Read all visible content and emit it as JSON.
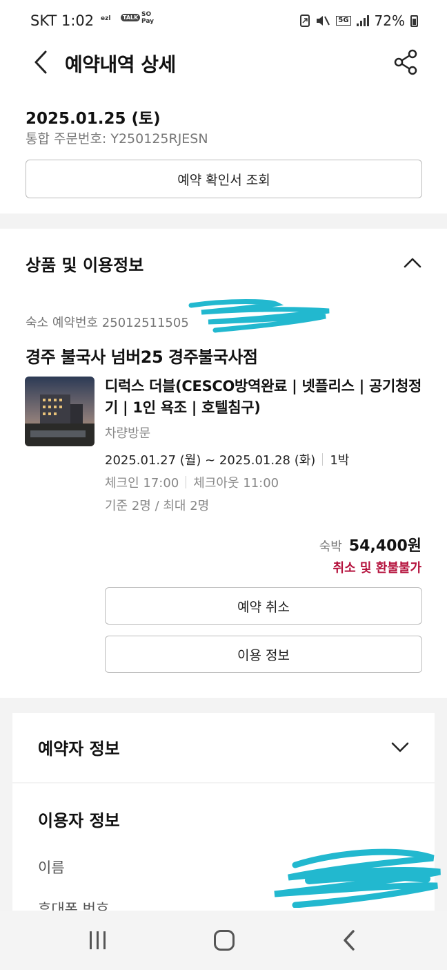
{
  "status_bar": {
    "carrier_time": "SKT 1:02",
    "icons": [
      "ezl",
      "TALK",
      "SO Pay"
    ],
    "network": "5G",
    "battery": "72%"
  },
  "header": {
    "title": "예약내역 상세",
    "back_icon": "chevron-left-icon",
    "share_icon": "share-icon"
  },
  "summary": {
    "date": "2025.01.25 (토)",
    "order_number": "통합 주문번호: Y250125RJESN",
    "confirm_button": "예약 확인서 조회"
  },
  "product_section": {
    "title": "상품 및 이용정보",
    "reservation_number": "숙소 예약번호 25012511505",
    "hotel_name": "경주 불국사 넘버25 경주불국사점",
    "room_name": "디럭스 더블(CESCO방역완료 | 넷플리스 | 공기청정기 | 1인 욕조 | 호텔침구)",
    "visit_type": "차량방문",
    "stay_dates": "2025.01.27 (월) ~ 2025.01.28 (화)",
    "nights": "1박",
    "check_in": "체크인 17:00",
    "check_out": "체크아웃 11:00",
    "guests": "기준 2명 / 최대 2명",
    "price_label": "숙박",
    "price": "54,400원",
    "refund_policy": "취소 및 환불불가",
    "cancel_button": "예약 취소",
    "info_button": "이용 정보"
  },
  "booker_section": {
    "title": "예약자 정보"
  },
  "user_section": {
    "title": "이용자 정보",
    "name_label": "이름",
    "phone_label": "휴대폰 번호"
  },
  "colors": {
    "accent_red": "#b5123d",
    "divider": "#f3f3f3",
    "scribble": "#22b8cf"
  }
}
